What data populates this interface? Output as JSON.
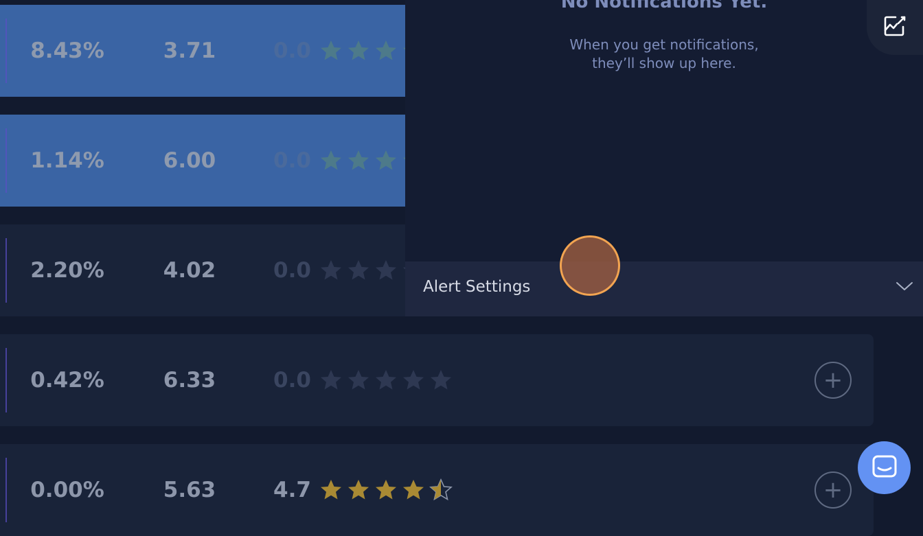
{
  "rows": [
    {
      "pct": "8.43%",
      "num": "3.71",
      "rating": "0.0",
      "stars": 0
    },
    {
      "pct": "1.14%",
      "num": "6.00",
      "rating": "0.0",
      "stars": 0
    },
    {
      "pct": "2.20%",
      "num": "4.02",
      "rating": "0.0",
      "stars": 0
    },
    {
      "pct": "0.42%",
      "num": "6.33",
      "rating": "0.0",
      "stars": 0
    },
    {
      "pct": "0.00%",
      "num": "5.63",
      "rating": "4.7",
      "stars": 4.5
    }
  ],
  "notifications": {
    "title": "No Notifications Yet.",
    "subtitle": "When you get notifications,\nthey’ll show up here."
  },
  "alert_settings": {
    "label": "Alert Settings"
  },
  "icons": {
    "add": "plus-circle-icon",
    "chart": "chart-edit-icon",
    "chevron": "chevron-down-icon",
    "chat": "chat-icon",
    "star": "star-icon"
  },
  "colors": {
    "highlight_row": "#3a64a4",
    "star_gold": "#a98a34",
    "chat_button": "#6392f3",
    "cursor_ring": "#f2a451"
  }
}
